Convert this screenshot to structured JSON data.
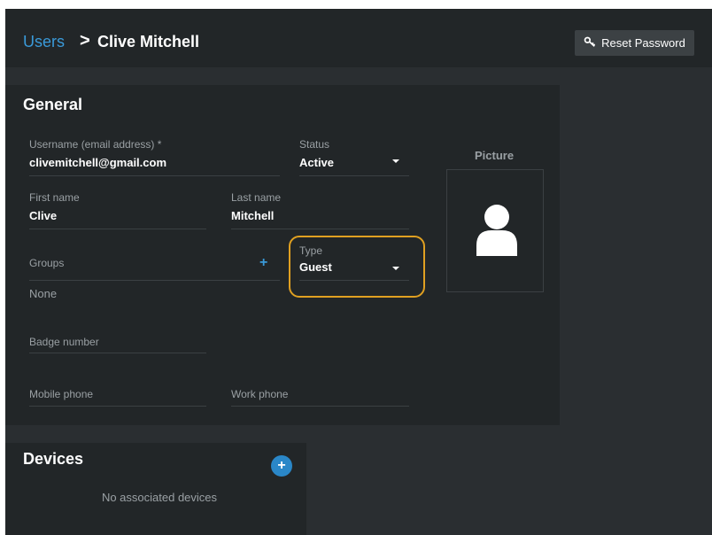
{
  "header": {
    "breadcrumb_parent": "Users",
    "breadcrumb_separator": ">",
    "title": "Clive Mitchell",
    "reset_password_label": "Reset Password"
  },
  "general": {
    "title": "General",
    "username": {
      "label": "Username (email address) *",
      "value": "clivemitchell@gmail.com"
    },
    "status": {
      "label": "Status",
      "value": "Active"
    },
    "picture_label": "Picture",
    "first_name": {
      "label": "First name",
      "value": "Clive"
    },
    "last_name": {
      "label": "Last name",
      "value": "Mitchell"
    },
    "groups": {
      "label": "Groups",
      "value": "None"
    },
    "type": {
      "label": "Type",
      "value": "Guest"
    },
    "badge_number": {
      "label": "Badge number",
      "value": ""
    },
    "mobile_phone": {
      "label": "Mobile phone",
      "value": ""
    },
    "work_phone": {
      "label": "Work phone",
      "value": ""
    }
  },
  "devices": {
    "title": "Devices",
    "empty_text": "No associated devices"
  },
  "colors": {
    "accent": "#3a9ad9",
    "highlight": "#e0a021",
    "panel": "#222628",
    "background": "#2a2e31"
  },
  "icons": [
    "key-icon",
    "chevron-down-icon",
    "plus-icon",
    "person-icon",
    "add-circle-icon"
  ]
}
